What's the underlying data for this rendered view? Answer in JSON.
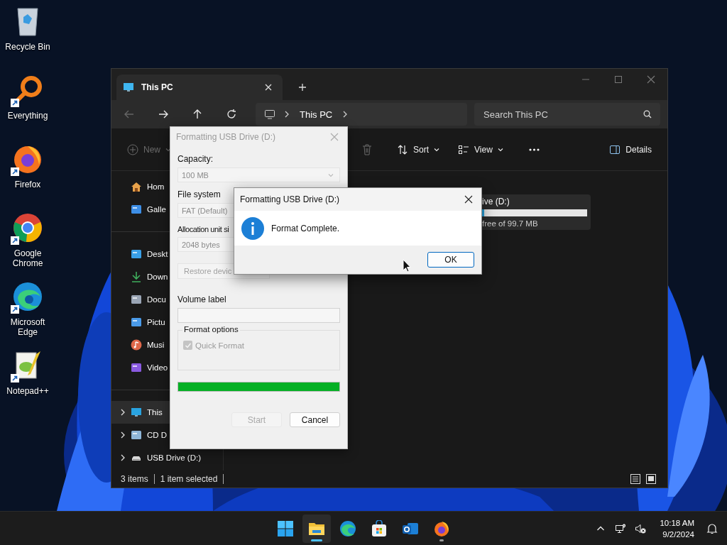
{
  "desktop_icons": [
    {
      "label": "Recycle Bin",
      "kind": "recycle_bin",
      "shortcut": false
    },
    {
      "label": "Everything",
      "kind": "everything",
      "shortcut": true
    },
    {
      "label": "Firefox",
      "kind": "firefox",
      "shortcut": true
    },
    {
      "label": "Google Chrome",
      "kind": "chrome",
      "shortcut": true
    },
    {
      "label": "Microsoft Edge",
      "kind": "edge",
      "shortcut": true
    },
    {
      "label": "Notepad++",
      "kind": "notepad",
      "shortcut": true
    }
  ],
  "explorer": {
    "tab": {
      "title": "This PC"
    },
    "nav": [
      {
        "kind": "back",
        "disabled": true
      },
      {
        "kind": "forward",
        "disabled": false
      },
      {
        "kind": "up",
        "disabled": false
      },
      {
        "kind": "refresh",
        "disabled": false
      }
    ],
    "breadcrumb": [
      "This PC"
    ],
    "search": {
      "placeholder": "Search This PC"
    },
    "toolbar": [
      {
        "kind": "new",
        "label": "New",
        "disabled": true
      },
      {
        "kind": "delete",
        "disabled": true
      },
      {
        "kind": "sort",
        "label": "Sort",
        "disabled": false
      },
      {
        "kind": "view",
        "label": "View",
        "disabled": false
      },
      {
        "kind": "more",
        "disabled": false
      },
      {
        "kind": "details",
        "label": "Details",
        "disabled": false
      }
    ],
    "sidebar": {
      "groups": [
        {
          "items": [
            {
              "kind": "home",
              "label": "Hom",
              "expandable": false,
              "selected": false
            },
            {
              "kind": "gallery",
              "label": "Galle",
              "expandable": false,
              "selected": false
            }
          ]
        },
        {
          "items": [
            {
              "kind": "desktop",
              "label": "Deskt",
              "expandable": false,
              "selected": false
            },
            {
              "kind": "downloads",
              "label": "Down",
              "expandable": false,
              "selected": false
            },
            {
              "kind": "documents",
              "label": "Docu",
              "expandable": false,
              "selected": false
            },
            {
              "kind": "pictures",
              "label": "Pictu",
              "expandable": false,
              "selected": false
            },
            {
              "kind": "music",
              "label": "Musi",
              "expandable": false,
              "selected": false
            },
            {
              "kind": "videos",
              "label": "Video",
              "expandable": false,
              "selected": false
            }
          ]
        },
        {
          "items": [
            {
              "kind": "pc",
              "label": "This",
              "expandable": true,
              "selected": true
            },
            {
              "kind": "cd",
              "label": "CD D",
              "expandable": true,
              "selected": false
            },
            {
              "kind": "usb",
              "label": "USB Drive (D:)",
              "expandable": true,
              "selected": false
            }
          ]
        }
      ]
    },
    "drive": {
      "name": "ive (D:)",
      "level": 0.02,
      "info": "free of 99.7 MB"
    },
    "status_bar": {
      "count": "3 items",
      "selection": "1 item selected"
    }
  },
  "format_dialog": {
    "title": "Formatting USB Drive (D:)",
    "capacity_label": "Capacity:",
    "capacity_value": "100 MB",
    "file_system_label": "File system",
    "file_system_value": "FAT (Default)",
    "allocation_label": "Allocation unit si",
    "allocation_value": "2048 bytes",
    "restore_button": "Restore devic",
    "volume_label": "Volume label",
    "options_title": "Format options",
    "quick_format": {
      "label": "Quick Format",
      "checked": true,
      "disabled": true
    },
    "progress": {
      "level": 1
    },
    "buttons": [
      {
        "label": "Start",
        "disabled": true
      },
      {
        "label": "Cancel",
        "disabled": false
      }
    ]
  },
  "message_box": {
    "title": "Formatting USB Drive (D:)",
    "kind": "info",
    "message": "Format Complete.",
    "button": "OK"
  },
  "taskbar": {
    "apps": [
      {
        "kind": "start",
        "active": false,
        "running": false
      },
      {
        "kind": "explorer",
        "active": true,
        "running": true
      },
      {
        "kind": "edge",
        "active": false,
        "running": false
      },
      {
        "kind": "store",
        "active": false,
        "running": false
      },
      {
        "kind": "mail",
        "active": false,
        "running": false
      },
      {
        "kind": "firefox",
        "active": false,
        "running": true
      }
    ],
    "time": "10:18 AM",
    "date": "9/2/2024"
  }
}
